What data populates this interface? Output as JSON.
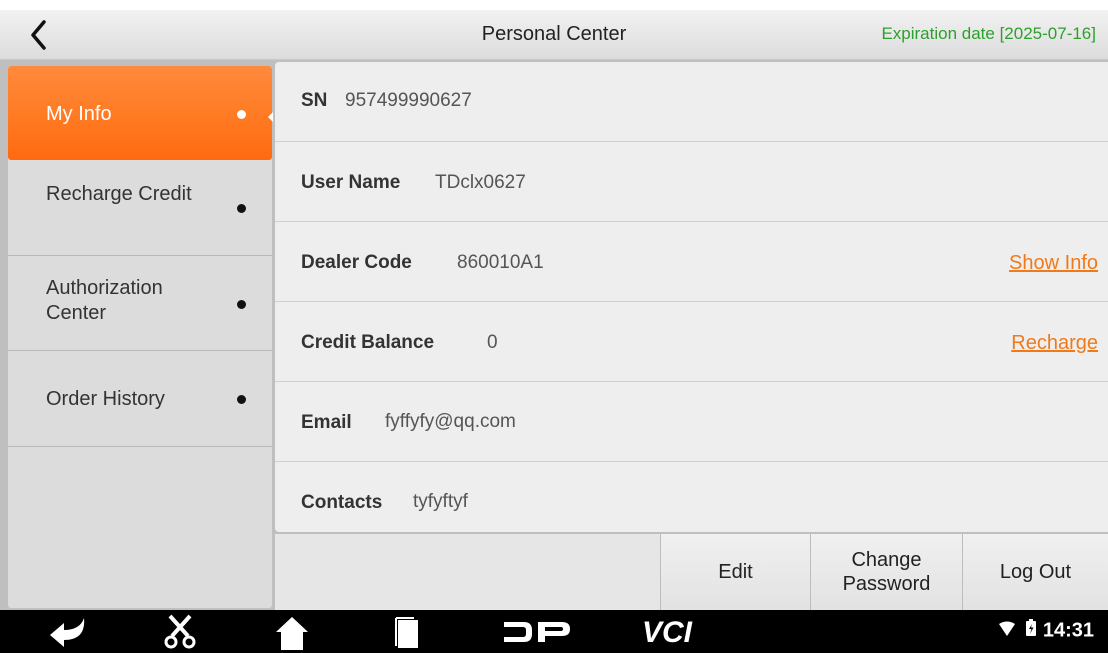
{
  "header": {
    "title": "Personal Center",
    "expiration": "Expiration date [2025-07-16]"
  },
  "sidebar": {
    "items": [
      {
        "label": "My Info",
        "active": true
      },
      {
        "label": "Recharge Credit",
        "active": false
      },
      {
        "label": "Authorization Center",
        "active": false
      },
      {
        "label": "Order History",
        "active": false
      }
    ]
  },
  "info": {
    "sn": {
      "key": "SN",
      "value": "957499990627"
    },
    "user_name": {
      "key": "User Name",
      "value": "TDclx0627"
    },
    "dealer_code": {
      "key": "Dealer Code",
      "value": "860010A1",
      "link": "Show Info"
    },
    "credit_balance": {
      "key": "Credit Balance",
      "value": "0",
      "link": "Recharge"
    },
    "email": {
      "key": "Email",
      "value": "fyffyfy@qq.com"
    },
    "contacts": {
      "key": "Contacts",
      "value": "tyfyftyf"
    }
  },
  "toolbar": {
    "edit": "Edit",
    "change_password": "Change Password",
    "log_out": "Log Out"
  },
  "navbar": {
    "icons": [
      "back-arrow-icon",
      "scissors-icon",
      "home-icon",
      "recents-icon",
      "dp-logo-icon",
      "vci-icon"
    ],
    "vci_label": "VCI",
    "time": "14:31"
  },
  "colors": {
    "accent": "#ff7a22",
    "expiration": "#2ca02c",
    "link": "#f07a1a"
  }
}
